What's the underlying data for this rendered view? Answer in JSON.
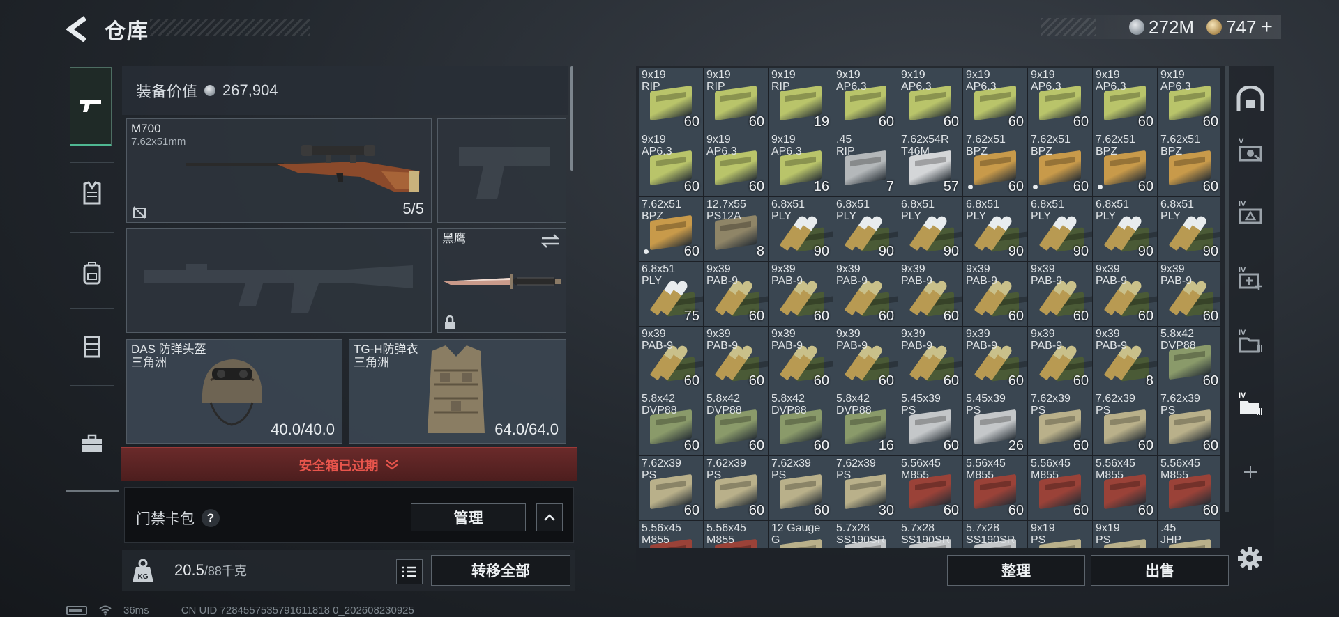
{
  "header": {
    "title": "仓库"
  },
  "currency": {
    "silver": "272M",
    "gold": "747",
    "gold_add": "+"
  },
  "nav": [
    "gun-icon",
    "vest-icon",
    "backpack-icon",
    "rig-icon",
    "case-icon"
  ],
  "loadout": {
    "value_label": "装备价值",
    "value": "267,904",
    "primary": {
      "name": "M700",
      "caliber": "7.62x51mm",
      "ammo": "5/5"
    },
    "melee": {
      "name": "黑鹰"
    },
    "helmet": {
      "name": "DAS 防弹头盔",
      "region": "三角洲",
      "durability": "40.0/40.0"
    },
    "armor": {
      "name": "TG-H防弹衣",
      "region": "三角洲",
      "durability": "64.0/64.0"
    },
    "expired_notice": "安全箱已过期",
    "keycard": {
      "label": "门禁卡包",
      "help": "?",
      "manage": "管理"
    },
    "weight": {
      "current": "20.5",
      "max": "/88千克"
    },
    "transfer_all": "转移全部"
  },
  "stash": {
    "sort": "整理",
    "sell": "出售",
    "items": [
      {
        "l1": "9x19",
        "l2": "RIP",
        "n": "60",
        "k": "box",
        "c": "#b9c46a"
      },
      {
        "l1": "9x19",
        "l2": "RIP",
        "n": "60",
        "k": "box",
        "c": "#b9c46a"
      },
      {
        "l1": "9x19",
        "l2": "RIP",
        "n": "19",
        "k": "box",
        "c": "#b9c46a"
      },
      {
        "l1": "9x19",
        "l2": "AP6.3",
        "n": "60",
        "k": "box",
        "c": "#b9c46a"
      },
      {
        "l1": "9x19",
        "l2": "AP6.3",
        "n": "60",
        "k": "box",
        "c": "#b9c46a"
      },
      {
        "l1": "9x19",
        "l2": "AP6.3",
        "n": "60",
        "k": "box",
        "c": "#b9c46a"
      },
      {
        "l1": "9x19",
        "l2": "AP6.3",
        "n": "60",
        "k": "box",
        "c": "#b9c46a"
      },
      {
        "l1": "9x19",
        "l2": "AP6.3",
        "n": "60",
        "k": "box",
        "c": "#b9c46a"
      },
      {
        "l1": "9x19",
        "l2": "AP6.3",
        "n": "60",
        "k": "box",
        "c": "#b9c46a"
      },
      {
        "l1": "9x19",
        "l2": "AP6.3",
        "n": "60",
        "k": "box",
        "c": "#b9c46a"
      },
      {
        "l1": "9x19",
        "l2": "AP6.3",
        "n": "60",
        "k": "box",
        "c": "#b9c46a"
      },
      {
        "l1": "9x19",
        "l2": "AP6.3",
        "n": "16",
        "k": "box",
        "c": "#b9c46a"
      },
      {
        "l1": ".45",
        "l2": "RIP",
        "n": "7",
        "k": "box",
        "c": "#b4b8ba"
      },
      {
        "l1": "7.62x54R",
        "l2": "T46M",
        "n": "57",
        "k": "box",
        "c": "#d4d6d8"
      },
      {
        "l1": "7.62x51",
        "l2": "BPZ",
        "n": "60",
        "k": "box",
        "c": "#c89a4a",
        "dot": true
      },
      {
        "l1": "7.62x51",
        "l2": "BPZ",
        "n": "60",
        "k": "box",
        "c": "#c89a4a",
        "dot": true
      },
      {
        "l1": "7.62x51",
        "l2": "BPZ",
        "n": "60",
        "k": "box",
        "c": "#c89a4a",
        "dot": true
      },
      {
        "l1": "7.62x51",
        "l2": "BPZ",
        "n": "60",
        "k": "box",
        "c": "#c89a4a"
      },
      {
        "l1": "7.62x51",
        "l2": "BPZ",
        "n": "60",
        "k": "box",
        "c": "#c89a4a",
        "dot": true
      },
      {
        "l1": "12.7x55",
        "l2": "PS12A",
        "n": "8",
        "k": "box",
        "c": "#8f8567"
      },
      {
        "l1": "6.8x51",
        "l2": "PLY",
        "n": "90",
        "k": "bullet",
        "c": "#e8ecee"
      },
      {
        "l1": "6.8x51",
        "l2": "PLY",
        "n": "90",
        "k": "bullet",
        "c": "#e8ecee"
      },
      {
        "l1": "6.8x51",
        "l2": "PLY",
        "n": "90",
        "k": "bullet",
        "c": "#e8ecee"
      },
      {
        "l1": "6.8x51",
        "l2": "PLY",
        "n": "90",
        "k": "bullet",
        "c": "#e8ecee"
      },
      {
        "l1": "6.8x51",
        "l2": "PLY",
        "n": "90",
        "k": "bullet",
        "c": "#e8ecee"
      },
      {
        "l1": "6.8x51",
        "l2": "PLY",
        "n": "90",
        "k": "bullet",
        "c": "#e8ecee"
      },
      {
        "l1": "6.8x51",
        "l2": "PLY",
        "n": "90",
        "k": "bullet",
        "c": "#e8ecee"
      },
      {
        "l1": "6.8x51",
        "l2": "PLY",
        "n": "75",
        "k": "bullet",
        "c": "#e8ecee"
      },
      {
        "l1": "9x39",
        "l2": "PAB-9",
        "n": "60",
        "k": "bullet",
        "c": "#c9c08a"
      },
      {
        "l1": "9x39",
        "l2": "PAB-9",
        "n": "60",
        "k": "bullet",
        "c": "#c9c08a"
      },
      {
        "l1": "9x39",
        "l2": "PAB-9",
        "n": "60",
        "k": "bullet",
        "c": "#c9c08a"
      },
      {
        "l1": "9x39",
        "l2": "PAB-9",
        "n": "60",
        "k": "bullet",
        "c": "#c9c08a"
      },
      {
        "l1": "9x39",
        "l2": "PAB-9",
        "n": "60",
        "k": "bullet",
        "c": "#c9c08a"
      },
      {
        "l1": "9x39",
        "l2": "PAB-9",
        "n": "60",
        "k": "bullet",
        "c": "#c9c08a"
      },
      {
        "l1": "9x39",
        "l2": "PAB-9",
        "n": "60",
        "k": "bullet",
        "c": "#c9c08a"
      },
      {
        "l1": "9x39",
        "l2": "PAB-9",
        "n": "60",
        "k": "bullet",
        "c": "#c9c08a"
      },
      {
        "l1": "9x39",
        "l2": "PAB-9",
        "n": "60",
        "k": "bullet",
        "c": "#c9c08a"
      },
      {
        "l1": "9x39",
        "l2": "PAB-9",
        "n": "60",
        "k": "bullet",
        "c": "#c9c08a"
      },
      {
        "l1": "9x39",
        "l2": "PAB-9",
        "n": "60",
        "k": "bullet",
        "c": "#c9c08a"
      },
      {
        "l1": "9x39",
        "l2": "PAB-9",
        "n": "60",
        "k": "bullet",
        "c": "#c9c08a"
      },
      {
        "l1": "9x39",
        "l2": "PAB-9",
        "n": "60",
        "k": "bullet",
        "c": "#c9c08a"
      },
      {
        "l1": "9x39",
        "l2": "PAB-9",
        "n": "60",
        "k": "bullet",
        "c": "#c9c08a"
      },
      {
        "l1": "9x39",
        "l2": "PAB-9",
        "n": "60",
        "k": "bullet",
        "c": "#c9c08a"
      },
      {
        "l1": "9x39",
        "l2": "PAB-9",
        "n": "8",
        "k": "bullet",
        "c": "#c9c08a"
      },
      {
        "l1": "5.8x42",
        "l2": "DVP88",
        "n": "60",
        "k": "box",
        "c": "#8a9a6a"
      },
      {
        "l1": "5.8x42",
        "l2": "DVP88",
        "n": "60",
        "k": "box",
        "c": "#8a9a6a"
      },
      {
        "l1": "5.8x42",
        "l2": "DVP88",
        "n": "60",
        "k": "box",
        "c": "#8a9a6a"
      },
      {
        "l1": "5.8x42",
        "l2": "DVP88",
        "n": "60",
        "k": "box",
        "c": "#8a9a6a"
      },
      {
        "l1": "5.8x42",
        "l2": "DVP88",
        "n": "16",
        "k": "box",
        "c": "#8a9a6a"
      },
      {
        "l1": "5.45x39",
        "l2": "PS",
        "n": "60",
        "k": "box",
        "c": "#c4c7c9"
      },
      {
        "l1": "5.45x39",
        "l2": "PS",
        "n": "26",
        "k": "box",
        "c": "#c4c7c9"
      },
      {
        "l1": "7.62x39",
        "l2": "PS",
        "n": "60",
        "k": "box",
        "c": "#b9b08a"
      },
      {
        "l1": "7.62x39",
        "l2": "PS",
        "n": "60",
        "k": "box",
        "c": "#b9b08a"
      },
      {
        "l1": "7.62x39",
        "l2": "PS",
        "n": "60",
        "k": "box",
        "c": "#b9b08a"
      },
      {
        "l1": "7.62x39",
        "l2": "PS",
        "n": "60",
        "k": "box",
        "c": "#b9b08a"
      },
      {
        "l1": "7.62x39",
        "l2": "PS",
        "n": "60",
        "k": "box",
        "c": "#b9b08a"
      },
      {
        "l1": "7.62x39",
        "l2": "PS",
        "n": "60",
        "k": "box",
        "c": "#b9b08a"
      },
      {
        "l1": "7.62x39",
        "l2": "PS",
        "n": "30",
        "k": "box",
        "c": "#b9b08a"
      },
      {
        "l1": "5.56x45",
        "l2": "M855",
        "n": "60",
        "k": "box",
        "c": "#9a4238"
      },
      {
        "l1": "5.56x45",
        "l2": "M855",
        "n": "60",
        "k": "box",
        "c": "#9a4238"
      },
      {
        "l1": "5.56x45",
        "l2": "M855",
        "n": "60",
        "k": "box",
        "c": "#9a4238"
      },
      {
        "l1": "5.56x45",
        "l2": "M855",
        "n": "60",
        "k": "box",
        "c": "#9a4238"
      },
      {
        "l1": "5.56x45",
        "l2": "M855",
        "n": "60",
        "k": "box",
        "c": "#9a4238"
      },
      {
        "l1": "5.56x45",
        "l2": "M855",
        "n": "",
        "k": "box",
        "c": "#9a4238"
      },
      {
        "l1": "5.56x45",
        "l2": "M855",
        "n": "",
        "k": "box",
        "c": "#9a4238"
      },
      {
        "l1": "12 Gauge",
        "l2": "G",
        "n": "",
        "k": "box",
        "c": "#b9b08a"
      },
      {
        "l1": "5.7x28",
        "l2": "SS190SR",
        "n": "",
        "k": "box",
        "c": "#c4c7c9"
      },
      {
        "l1": "5.7x28",
        "l2": "SS190SR",
        "n": "",
        "k": "box",
        "c": "#c4c7c9"
      },
      {
        "l1": "5.7x28",
        "l2": "SS190SR",
        "n": "",
        "k": "box",
        "c": "#c4c7c9"
      },
      {
        "l1": "9x19",
        "l2": "PS",
        "n": "",
        "k": "box",
        "c": "#b9b08a"
      },
      {
        "l1": "9x19",
        "l2": "PS",
        "n": "",
        "k": "box",
        "c": "#b9b08a"
      },
      {
        "l1": ".45",
        "l2": "JHP",
        "n": "",
        "k": "box",
        "c": "#b9b08a"
      }
    ]
  },
  "right_tabs": [
    {
      "label": "",
      "icon": "safe-box-icon"
    },
    {
      "label": "V",
      "icon": "camera-case-icon"
    },
    {
      "label": "IV",
      "icon": "triangle-case-icon"
    },
    {
      "label": "IV",
      "icon": "medkit-case-icon"
    },
    {
      "label": "IV",
      "icon": "folder-case-icon"
    },
    {
      "label": "IV",
      "icon": "folder-case-active-icon"
    },
    {
      "label": "",
      "icon": "plus-icon"
    }
  ],
  "status": {
    "ping": "36ms",
    "uid": "CN UID 7284557535791611818 0_202608230925"
  },
  "colors": {
    "accent_green": "#4fb892",
    "warning_red": "#e8554c"
  }
}
